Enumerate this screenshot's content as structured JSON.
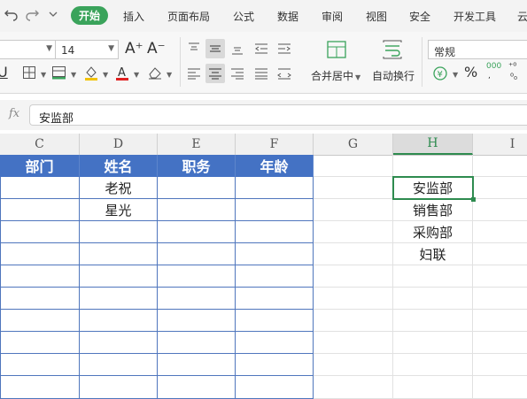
{
  "menubar": {
    "tabs": [
      "开始",
      "插入",
      "页面布局",
      "公式",
      "数据",
      "审阅",
      "视图",
      "安全",
      "开发工具",
      "云"
    ]
  },
  "ribbon": {
    "font_size": "14",
    "font_inc_glyph": "A⁺",
    "font_dec_glyph": "A⁻",
    "merge_label": "合并居中",
    "wrap_label": "自动换行",
    "number_format": "常规",
    "percent_glyph": "%",
    "decimal_glyph": "000",
    "decimal2_glyph": "⁺⁰",
    "decimal3_glyph": "⁰₀"
  },
  "formula_bar": {
    "fx_label": "fx",
    "value": "安监部"
  },
  "sheet": {
    "columns": [
      "C",
      "D",
      "E",
      "F",
      "G",
      "H",
      "I"
    ],
    "table_headers": [
      "部门",
      "姓名",
      "职务",
      "年龄"
    ],
    "names": [
      "老祝",
      "星光"
    ],
    "h_list": [
      "安监部",
      "销售部",
      "采购部",
      "妇联"
    ]
  },
  "colors": {
    "accent_green": "#3aa35b",
    "table_header_blue": "#4472c4",
    "table_border_blue": "#4f76bd",
    "active_cell_green": "#2e8b4f"
  }
}
